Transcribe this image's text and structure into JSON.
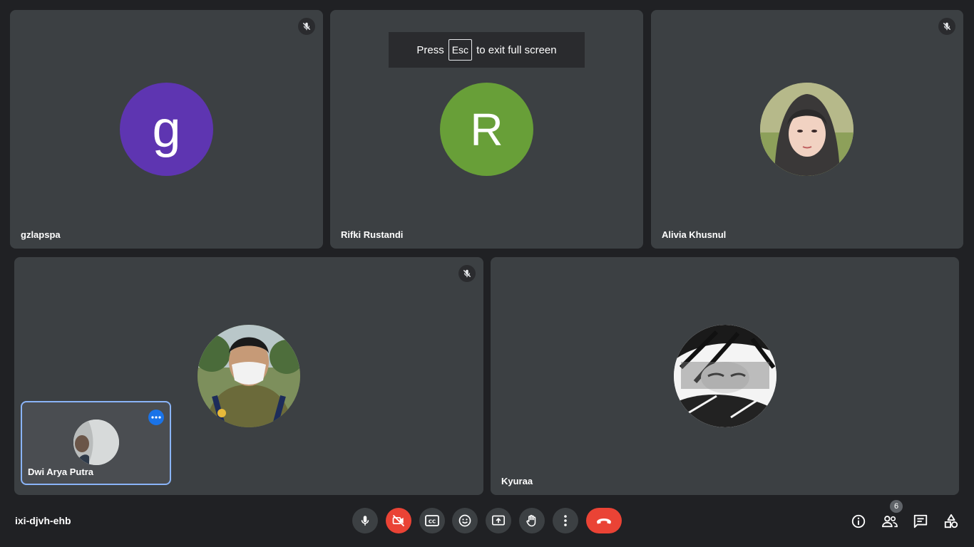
{
  "toast": {
    "prefix": "Press",
    "key": "Esc",
    "suffix": "to exit full screen"
  },
  "participants": [
    {
      "name": "gzlapspa",
      "initial": "g",
      "avatar_color": "#5e35b1",
      "muted": true
    },
    {
      "name": "Rifki Rustandi",
      "initial": "R",
      "avatar_color": "#689f38",
      "muted": false
    },
    {
      "name": "Alivia Khusnul",
      "muted": true
    },
    {
      "muted": true
    },
    {
      "name": "Kyuraa",
      "muted": false
    }
  ],
  "self_view": {
    "name": "Dwi Arya Putra"
  },
  "meeting": {
    "code": "ixi-djvh-ehb"
  },
  "controls": {
    "icons": [
      "mic-icon",
      "camera-off-icon",
      "captions-icon",
      "emoji-icon",
      "present-icon",
      "raise-hand-icon",
      "more-options-icon",
      "end-call-icon"
    ]
  },
  "right_controls": {
    "people_count": "6",
    "icons": [
      "info-icon",
      "people-icon",
      "chat-icon",
      "activities-icon"
    ]
  },
  "colors": {
    "background": "#202124",
    "tile": "#3c4043",
    "danger": "#ea4335",
    "accent": "#8ab4f8"
  }
}
